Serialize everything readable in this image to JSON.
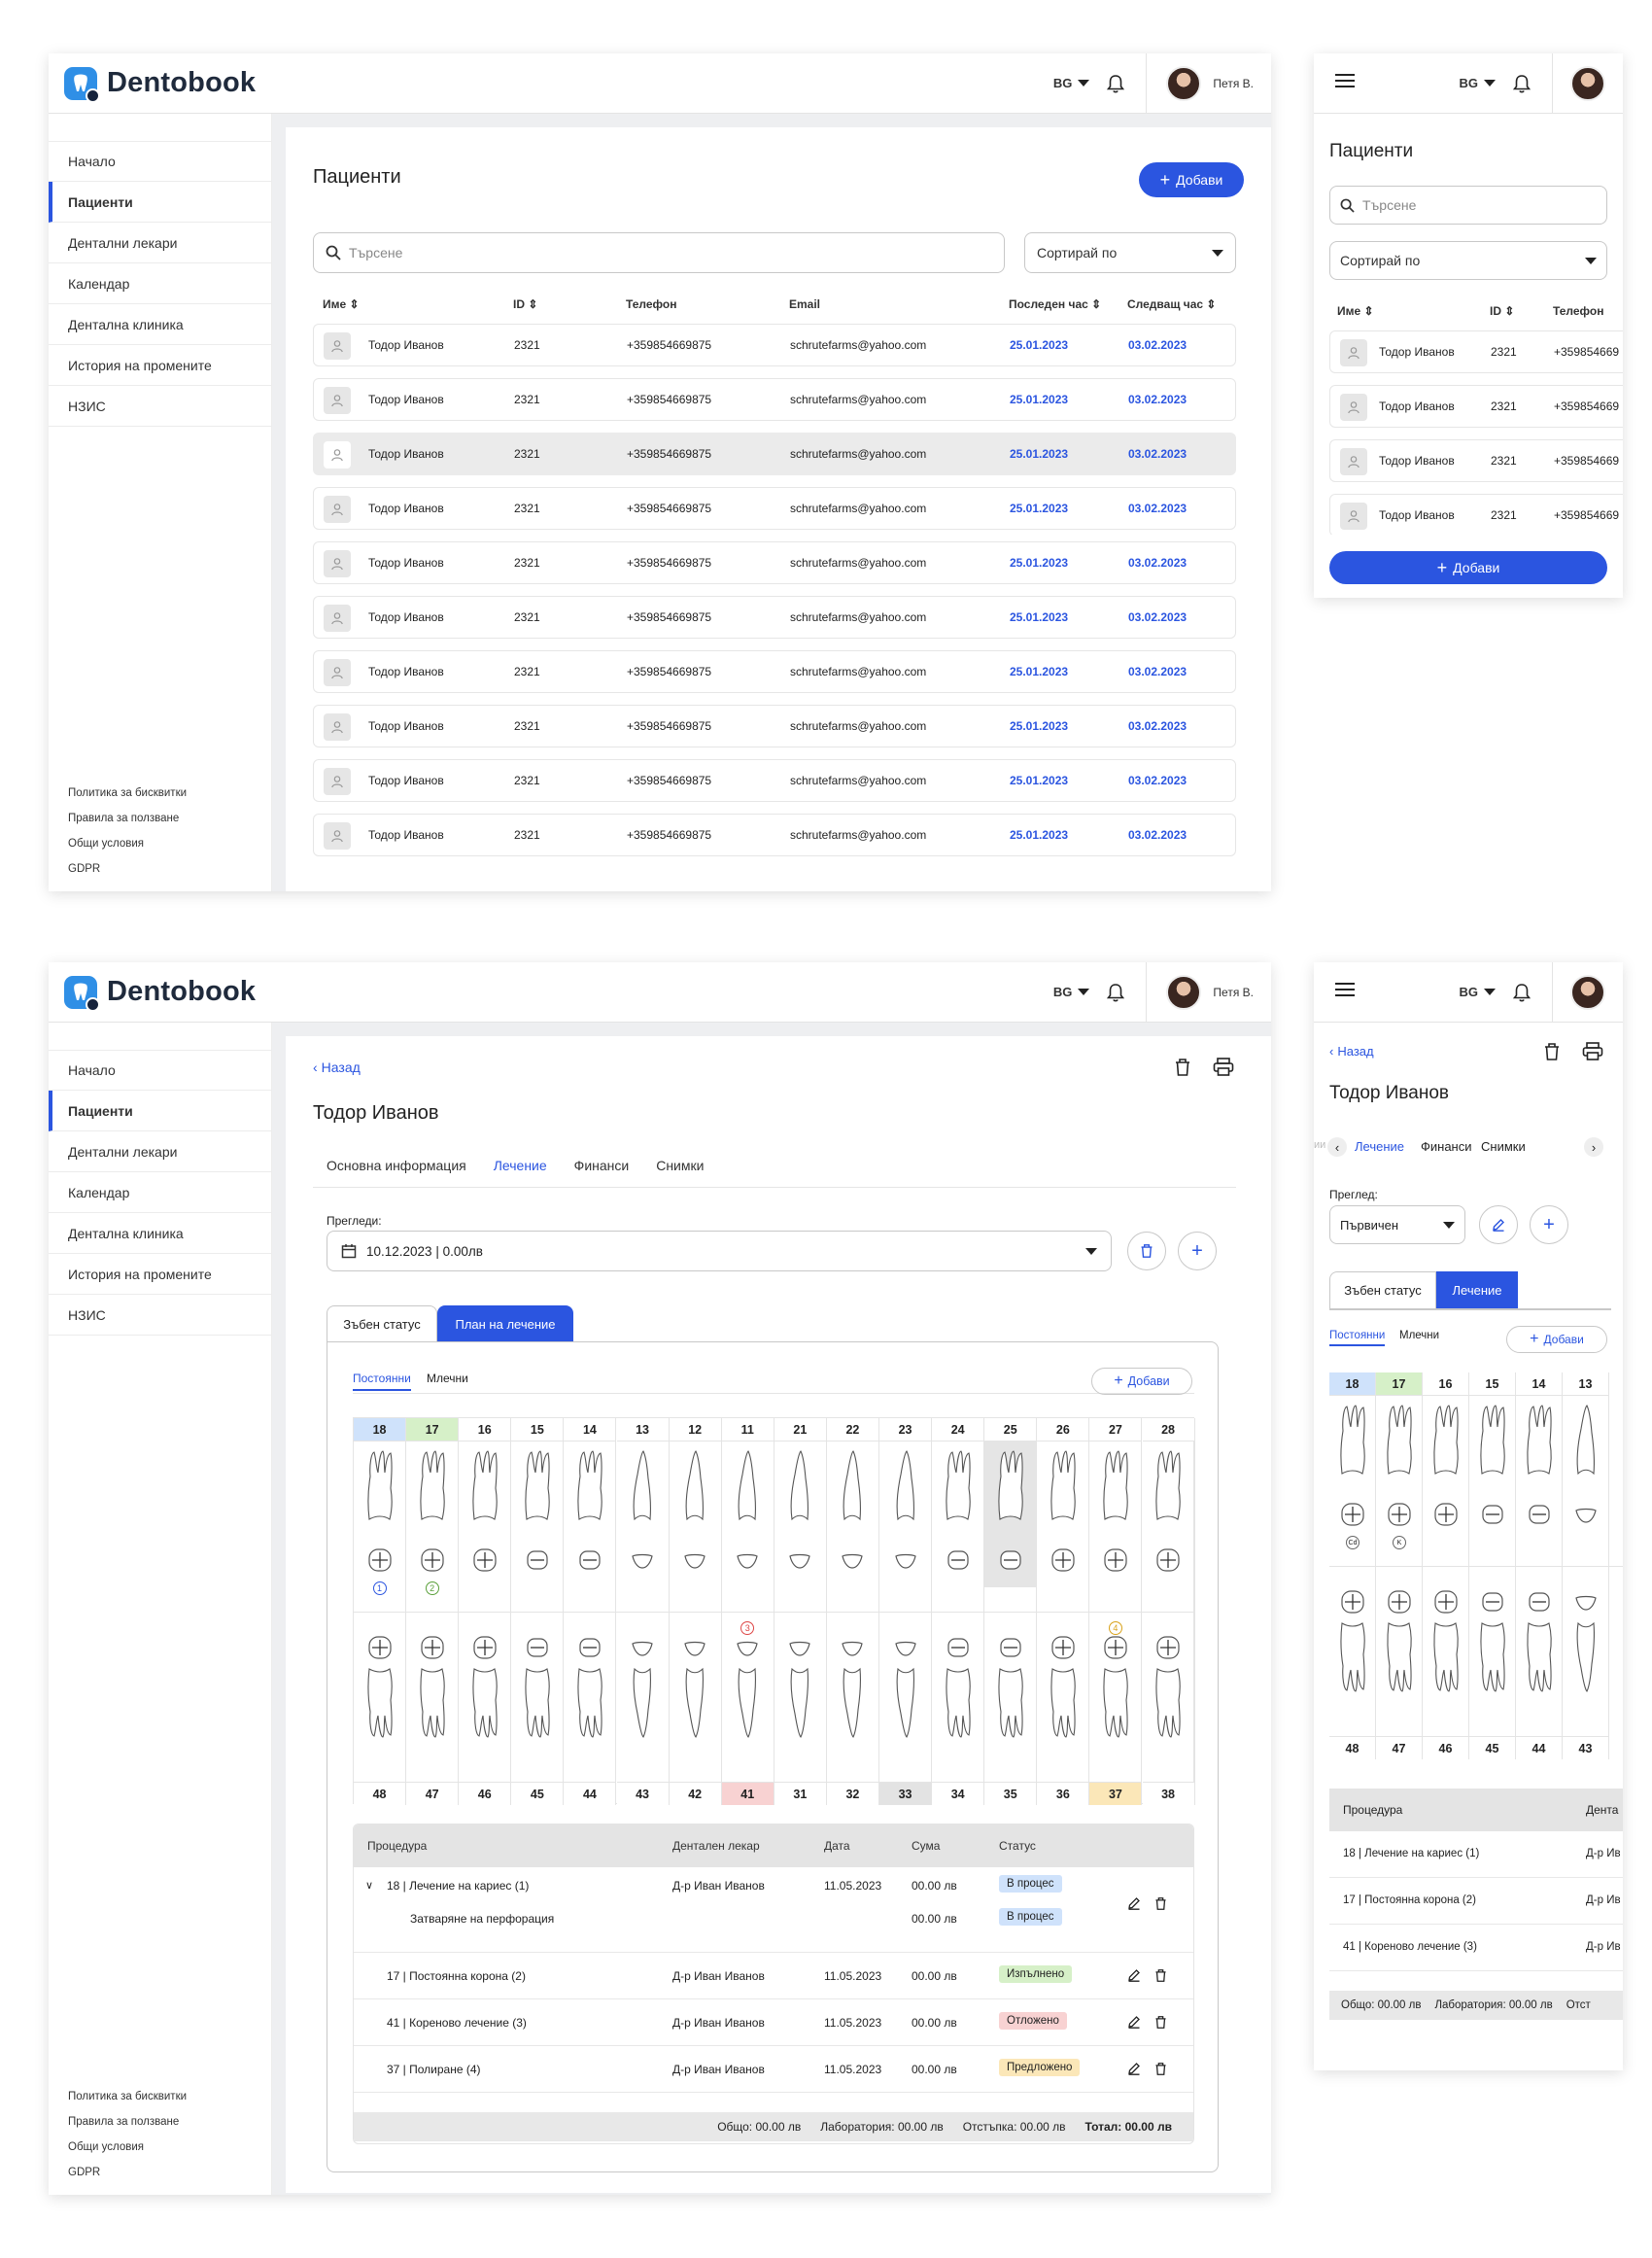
{
  "app": {
    "name": "Dentobook",
    "lang": "BG",
    "user": "Петя В."
  },
  "sidebar": {
    "items": [
      "Начало",
      "Пациенти",
      "Дентални лекари",
      "Календар",
      "Дентална клиника",
      "История на промените",
      "НЗИС"
    ],
    "active": "Пациенти",
    "footer": [
      "Политика за бисквитки",
      "Правила за ползване",
      "Общи условия",
      "GDPR"
    ]
  },
  "patients": {
    "title": "Пациенти",
    "add": "Добави",
    "search_placeholder": "Търсене",
    "sort": "Сортирай по",
    "columns": [
      "Име",
      "ID",
      "Телефон",
      "Email",
      "Последен час",
      "Следващ час"
    ],
    "rows": [
      {
        "name": "Тодор Иванов",
        "id": "2321",
        "phone": "+359854669875",
        "email": "schrutefarms@yahoo.com",
        "last": "25.01.2023",
        "next": "03.02.2023"
      },
      {
        "name": "Тодор Иванов",
        "id": "2321",
        "phone": "+359854669875",
        "email": "schrutefarms@yahoo.com",
        "last": "25.01.2023",
        "next": "03.02.2023"
      },
      {
        "name": "Тодор Иванов",
        "id": "2321",
        "phone": "+359854669875",
        "email": "schrutefarms@yahoo.com",
        "last": "25.01.2023",
        "next": "03.02.2023"
      },
      {
        "name": "Тодор Иванов",
        "id": "2321",
        "phone": "+359854669875",
        "email": "schrutefarms@yahoo.com",
        "last": "25.01.2023",
        "next": "03.02.2023"
      },
      {
        "name": "Тодор Иванов",
        "id": "2321",
        "phone": "+359854669875",
        "email": "schrutefarms@yahoo.com",
        "last": "25.01.2023",
        "next": "03.02.2023"
      },
      {
        "name": "Тодор Иванов",
        "id": "2321",
        "phone": "+359854669875",
        "email": "schrutefarms@yahoo.com",
        "last": "25.01.2023",
        "next": "03.02.2023"
      },
      {
        "name": "Тодор Иванов",
        "id": "2321",
        "phone": "+359854669875",
        "email": "schrutefarms@yahoo.com",
        "last": "25.01.2023",
        "next": "03.02.2023"
      },
      {
        "name": "Тодор Иванов",
        "id": "2321",
        "phone": "+359854669875",
        "email": "schrutefarms@yahoo.com",
        "last": "25.01.2023",
        "next": "03.02.2023"
      },
      {
        "name": "Тодор Иванов",
        "id": "2321",
        "phone": "+359854669875",
        "email": "schrutefarms@yahoo.com",
        "last": "25.01.2023",
        "next": "03.02.2023"
      },
      {
        "name": "Тодор Иванов",
        "id": "2321",
        "phone": "+359854669875",
        "email": "schrutefarms@yahoo.com",
        "last": "25.01.2023",
        "next": "03.02.2023"
      }
    ],
    "highlighted_row": 3,
    "mobile_columns": [
      "Име",
      "ID",
      "Телефон"
    ],
    "mobile_phone": "+359854669"
  },
  "patient": {
    "back": "Назад",
    "name": "Тодор Иванов",
    "tabs": [
      "Основна информация",
      "Лечение",
      "Финанси",
      "Снимки"
    ],
    "active_tab": "Лечение",
    "exam_label": "Прегледи:",
    "exam_value": "10.12.2023 | 0.00лв",
    "subtabs": [
      "Зъбен статус",
      "План на лечение"
    ],
    "active_subtab": "План на лечение",
    "dentition": [
      "Постоянни",
      "Млечни"
    ],
    "add": "Добави",
    "upper_teeth": [
      "18",
      "17",
      "16",
      "15",
      "14",
      "13",
      "12",
      "11",
      "21",
      "22",
      "23",
      "24",
      "25",
      "26",
      "27",
      "28"
    ],
    "lower_teeth": [
      "48",
      "47",
      "46",
      "45",
      "44",
      "43",
      "42",
      "41",
      "31",
      "32",
      "33",
      "34",
      "35",
      "36",
      "37",
      "38"
    ],
    "upper_highlights": {
      "18": "#cfe2fb",
      "17": "#d6f0c8"
    },
    "lower_highlights": {
      "41": "#f8d2d2",
      "33": "#e3e3e3",
      "37": "#fbe7b8"
    },
    "marks_upper": {
      "18": "1",
      "17": "2"
    },
    "marks_lower": {
      "11": "3",
      "27": "4"
    },
    "proc_columns": [
      "Процедура",
      "Дентален лекар",
      "Дата",
      "Сума",
      "Статус"
    ],
    "procedures": [
      {
        "name": "18 | Лечение на кариес (1)",
        "sub": "Затваряне на перфорация",
        "doctor": "Д-р Иван Иванов",
        "date": "11.05.2023",
        "sum": "00.00 лв",
        "sum2": "00.00 лв",
        "status": "В процес",
        "status2": "В процес",
        "color": "#cfe2fb"
      },
      {
        "name": "17 | Постоянна корона (2)",
        "doctor": "Д-р Иван Иванов",
        "date": "11.05.2023",
        "sum": "00.00 лв",
        "status": "Изпълнено",
        "color": "#d6f0c8"
      },
      {
        "name": "41 | Кореново лечение (3)",
        "doctor": "Д-р Иван Иванов",
        "date": "11.05.2023",
        "sum": "00.00 лв",
        "status": "Отложено",
        "color": "#f8d2d2"
      },
      {
        "name": "37 | Полиране (4)",
        "doctor": "Д-р Иван Иванов",
        "date": "11.05.2023",
        "sum": "00.00 лв",
        "status": "Предложено",
        "color": "#fbe7b8"
      }
    ],
    "totals": [
      "Общо: 00.00 лв",
      "Лаборатория: 00.00 лв",
      "Отстъпка: 00.00 лв",
      "Тотал: 00.00 лв"
    ],
    "mobile_exam_label": "Преглед:",
    "mobile_exam_value": "Първичен",
    "mobile_tabs_partial": "ии",
    "mobile_upper": [
      "18",
      "17",
      "16",
      "15",
      "14",
      "13"
    ],
    "mobile_lower": [
      "48",
      "47",
      "46",
      "45",
      "44",
      "43"
    ],
    "mobile_marks": [
      "Cd",
      "K"
    ],
    "mobile_proc_columns": [
      "Процедура",
      "Дента"
    ],
    "mobile_doctor_partial": "Д-р Ив",
    "mobile_totals": [
      "Общо: 00.00 лв",
      "Лаборатория: 00.00 лв",
      "Отст"
    ]
  }
}
